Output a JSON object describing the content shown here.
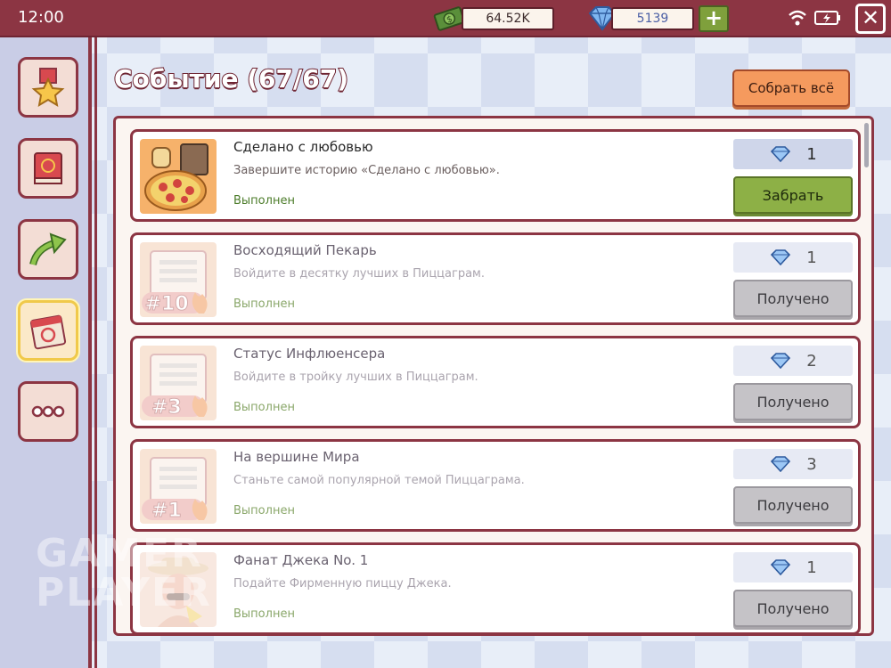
{
  "status_bar": {
    "time": "12:00"
  },
  "currency": {
    "cash": "64.52K",
    "gems": "5139",
    "add_label": "+"
  },
  "close_label": "✕",
  "sidebar": {
    "items": [
      {
        "name": "medal-icon"
      },
      {
        "name": "recipe-book-icon"
      },
      {
        "name": "growth-arrow-icon"
      },
      {
        "name": "calendar-event-icon",
        "active": true
      },
      {
        "name": "more-icon"
      }
    ]
  },
  "header": {
    "title": "Событие (67/67)",
    "collect_all_label": "Собрать всё"
  },
  "tasks": [
    {
      "title": "Сделано с любовью",
      "description": "Завершите историю «Сделано с любовью».",
      "status": "Выполнен",
      "reward": "1",
      "action": "Забрать",
      "claimable": true,
      "thumb": "pizza"
    },
    {
      "title": "Восходящий Пекарь",
      "description": "Войдите в десятку лучших в Пиццаграм.",
      "status": "Выполнен",
      "reward": "1",
      "action": "Получено",
      "claimable": false,
      "thumb": "rank",
      "rank": "#10"
    },
    {
      "title": "Статус Инфлюенсера",
      "description": "Войдите в тройку лучших в Пиццаграм.",
      "status": "Выполнен",
      "reward": "2",
      "action": "Получено",
      "claimable": false,
      "thumb": "rank",
      "rank": "#3"
    },
    {
      "title": "На вершине Мира",
      "description": "Станьте самой популярной темой Пиццаграма.",
      "status": "Выполнен",
      "reward": "3",
      "action": "Получено",
      "claimable": false,
      "thumb": "rank",
      "rank": "#1"
    },
    {
      "title": "Фанат Джека No. 1",
      "description": "Подайте Фирменную пиццу Джека.",
      "status": "Выполнен",
      "reward": "1",
      "action": "Получено",
      "claimable": false,
      "thumb": "jack"
    }
  ],
  "watermark": {
    "line1": "GAMER",
    "line2": "PLAYER"
  },
  "colors": {
    "frame": "#8c3543",
    "claim": "#8db046",
    "collect": "#f59a5e",
    "received": "#c5c3c7"
  }
}
